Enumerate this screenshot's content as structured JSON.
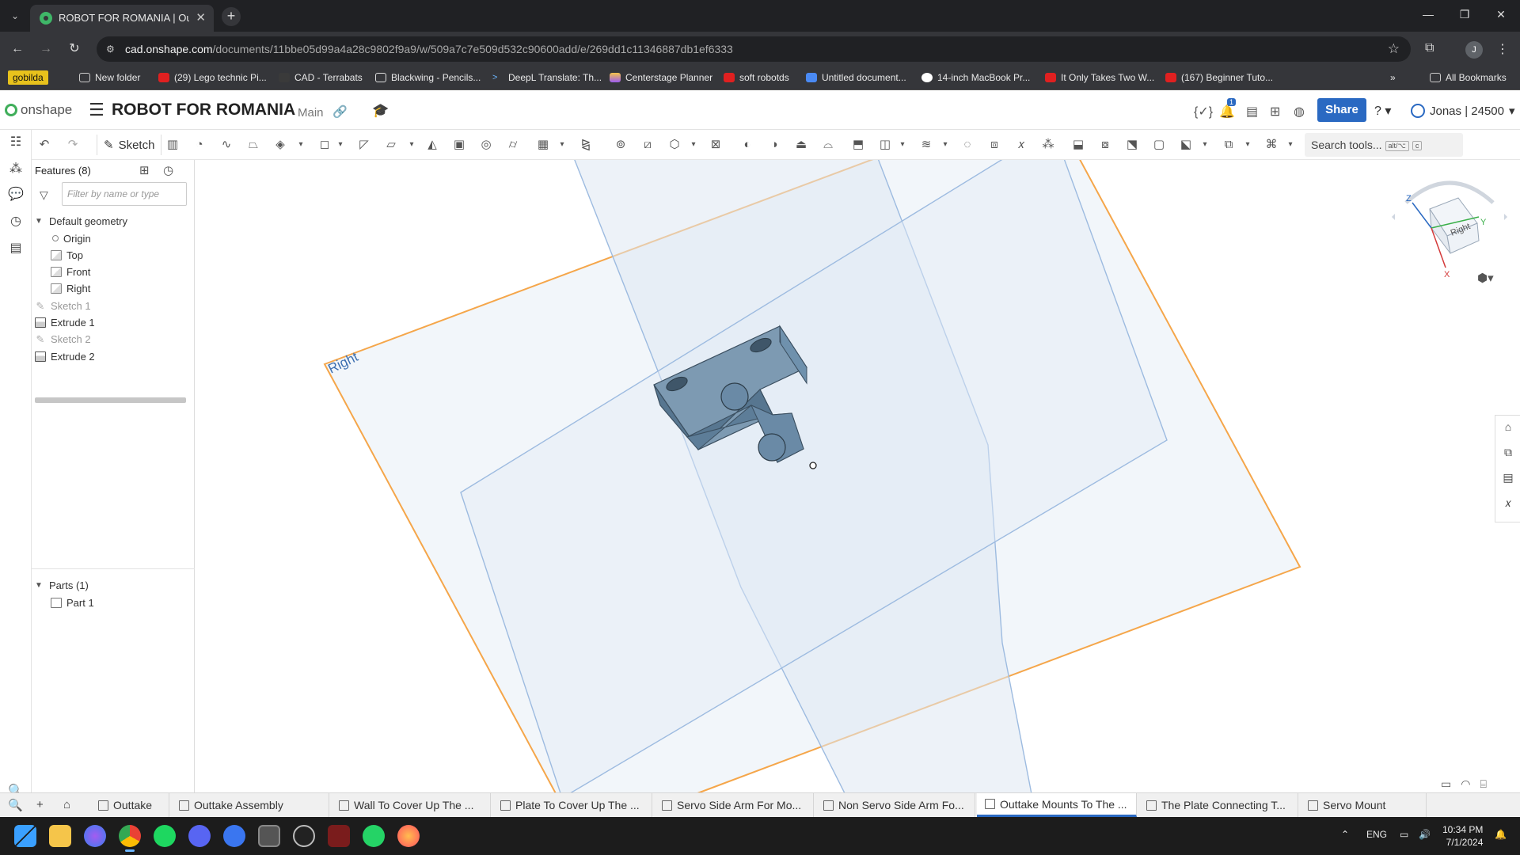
{
  "browser": {
    "tab_title": "ROBOT FOR ROMANIA | Outtake",
    "url_host": "cad.onshape.com",
    "url_path": "/documents/11bbe05d99a4a28c9802f9a9/w/509a7c7e509d532c90600add/e/269dd1c11346887db1ef6333",
    "profile_initial": "J",
    "bookmarks": [
      "gobilda",
      "New folder",
      "(29) Lego technic Pi...",
      "CAD - Terrabats",
      "Blackwing - Pencils...",
      "DeepL Translate: Th...",
      "Centerstage Planner",
      "soft robotds",
      "Untitled document...",
      "14-inch MacBook Pr...",
      "It Only Takes Two W...",
      "(167) Beginner Tuto..."
    ],
    "all_bookmarks": "All Bookmarks"
  },
  "onshape": {
    "logo_text": "onshape",
    "document_title": "ROBOT FOR ROMANIA",
    "branch": "Main",
    "notification_count": "1",
    "share_label": "Share",
    "user_label": "Jonas | 24500",
    "sketch_label": "Sketch",
    "search_tools_placeholder": "Search tools...",
    "search_shortcut_1": "alt/⌥",
    "search_shortcut_2": "c"
  },
  "feature_tree": {
    "title": "Features (8)",
    "filter_placeholder": "Filter by name or type",
    "default_geometry": "Default geometry",
    "items": [
      {
        "label": "Origin",
        "kind": "origin",
        "indent": true,
        "dim": false
      },
      {
        "label": "Top",
        "kind": "plane",
        "indent": true,
        "dim": false
      },
      {
        "label": "Front",
        "kind": "plane",
        "indent": true,
        "dim": false
      },
      {
        "label": "Right",
        "kind": "plane",
        "indent": true,
        "dim": false
      },
      {
        "label": "Sketch 1",
        "kind": "sketch",
        "indent": false,
        "dim": true
      },
      {
        "label": "Extrude 1",
        "kind": "extrude",
        "indent": false,
        "dim": false
      },
      {
        "label": "Sketch 2",
        "kind": "sketch",
        "indent": false,
        "dim": true
      },
      {
        "label": "Extrude 2",
        "kind": "extrude",
        "indent": false,
        "dim": false
      }
    ],
    "parts_title": "Parts (1)",
    "parts": [
      "Part 1"
    ]
  },
  "viewport": {
    "plane_label": "Right",
    "viewcube_face": "Right",
    "axis_z": "Z",
    "axis_y": "Y",
    "axis_x": "X",
    "plane_highlight_color": "#f5a64a",
    "plane_fill_color": "#e3ecf6",
    "plane_edge_color": "#9dbbe0",
    "part_color": "#5f7f99"
  },
  "bottom_tabs": [
    {
      "label": "Outtake",
      "kind": "folder",
      "active": false
    },
    {
      "label": "Outtake Assembly",
      "kind": "assembly",
      "active": false
    },
    {
      "label": "Wall To Cover Up The ...",
      "kind": "part",
      "active": false
    },
    {
      "label": "Plate To Cover Up The ...",
      "kind": "part",
      "active": false
    },
    {
      "label": "Servo Side Arm For Mo...",
      "kind": "part",
      "active": false
    },
    {
      "label": "Non Servo Side Arm Fo...",
      "kind": "part",
      "active": false
    },
    {
      "label": "Outtake Mounts To The ...",
      "kind": "part",
      "active": true
    },
    {
      "label": "The Plate Connecting T...",
      "kind": "part",
      "active": false
    },
    {
      "label": "Servo Mount",
      "kind": "part",
      "active": false
    }
  ],
  "taskbar": {
    "language": "ENG",
    "time": "10:34 PM",
    "date": "7/1/2024",
    "apps": [
      "windows-start",
      "file-explorer",
      "messenger",
      "chrome",
      "spotify",
      "discord",
      "signal",
      "app-tile",
      "obs",
      "autodesk",
      "whatsapp",
      "firefox"
    ]
  }
}
